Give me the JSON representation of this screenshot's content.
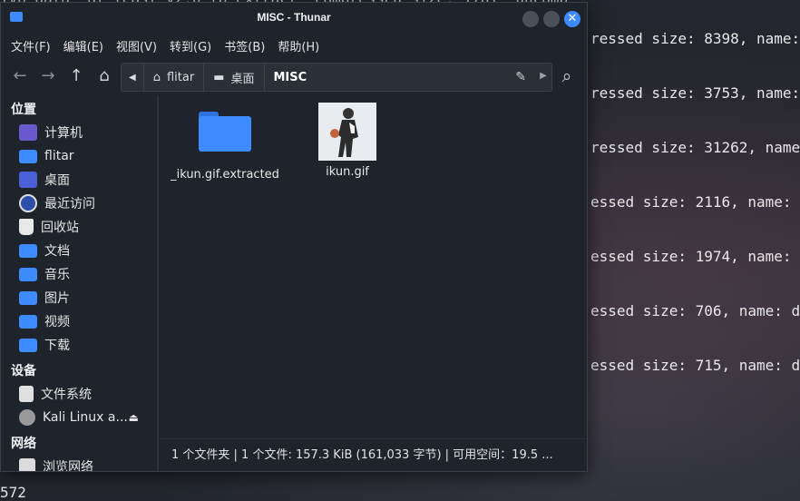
{
  "terminal": {
    "top_line": "ivo data  at least v2.0 to extract  compressed size: 1761  uncomp",
    "lines": [
      "ressed size: 8398, name:",
      "ressed size: 3753, name:",
      "ressed size: 31262, name",
      "essed size: 2116, name:",
      "essed size: 1974, name:",
      "essed size: 706, name: d",
      "essed size: 715, name: d"
    ],
    "bottom_line": "572"
  },
  "window": {
    "title": "MISC - Thunar",
    "close_glyph": "✕"
  },
  "menu": [
    "文件(F)",
    "编辑(E)",
    "视图(V)",
    "转到(G)",
    "书签(B)",
    "帮助(H)"
  ],
  "path": {
    "crumbs": [
      "flitar",
      "桌面",
      "MISC"
    ]
  },
  "sidebar": {
    "places_header": "位置",
    "places": [
      {
        "label": "计算机",
        "icon": "computer-icon"
      },
      {
        "label": "flitar",
        "icon": "folder-home-icon"
      },
      {
        "label": "桌面",
        "icon": "desktop-icon"
      },
      {
        "label": "最近访问",
        "icon": "recent-icon"
      },
      {
        "label": "回收站",
        "icon": "trash-icon"
      },
      {
        "label": "文档",
        "icon": "folder-documents-icon"
      },
      {
        "label": "音乐",
        "icon": "folder-music-icon"
      },
      {
        "label": "图片",
        "icon": "folder-pictures-icon"
      },
      {
        "label": "视频",
        "icon": "folder-videos-icon"
      },
      {
        "label": "下载",
        "icon": "folder-download-icon"
      }
    ],
    "devices_header": "设备",
    "devices": [
      {
        "label": "文件系统",
        "icon": "filesystem-icon"
      },
      {
        "label": "Kali Linux a...",
        "icon": "optical-disc-icon",
        "eject": "⏏"
      }
    ],
    "network_header": "网络",
    "network": [
      {
        "label": "浏览网络",
        "icon": "network-icon"
      }
    ]
  },
  "files": [
    {
      "name": "_ikun.gif.extracted",
      "type": "folder"
    },
    {
      "name": "ikun.gif",
      "type": "image"
    }
  ],
  "status": "1 个文件夹 | 1 个文件: 157.3 KiB (161,033 字节) | 可用空间：19.5 ...",
  "colors": {
    "accent": "#3d8bff",
    "window_bg": "#1f232b"
  }
}
